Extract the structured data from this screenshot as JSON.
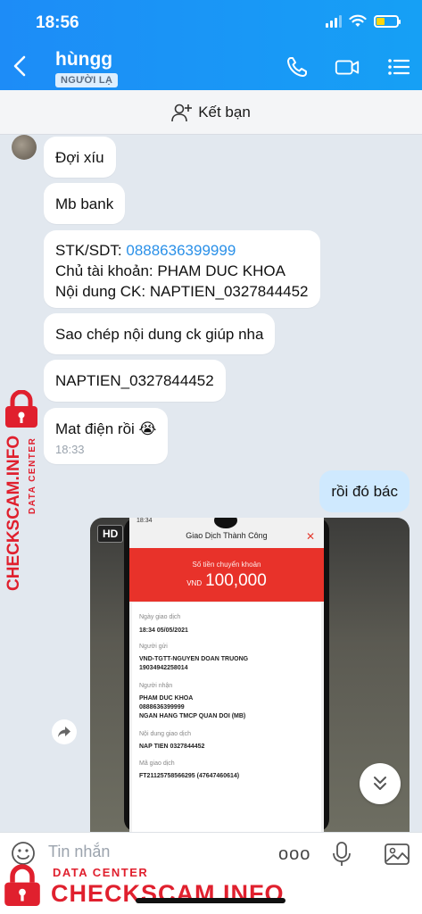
{
  "status_bar": {
    "time": "18:56"
  },
  "header": {
    "contact_name": "hùngg",
    "contact_badge": "NGƯỜI LẠ"
  },
  "add_friend": {
    "label": "Kết bạn"
  },
  "messages": [
    {
      "text": "Đợi xíu"
    },
    {
      "text": "Mb bank"
    },
    {
      "lines": [
        "STK/SDT: ",
        "Chủ tài khoản: PHAM DUC KHOA",
        "Nội dung CK: NAPTIEN_0327844452"
      ],
      "phone": "0888636399999"
    },
    {
      "text": "Sao chép nội dung ck giúp nha"
    },
    {
      "text": "NAPTIEN_0327844452"
    },
    {
      "text": "Mat điện rồi 😭",
      "time": "18:33"
    }
  ],
  "outgoing": {
    "text": "rồi đó bác"
  },
  "photo": {
    "badge": "HD",
    "screen": {
      "status_time": "18:34",
      "title": "Giao Dịch Thành Công",
      "amount_label": "Số tiền chuyển khoản",
      "currency": "VND",
      "amount": "100,000",
      "date_label": "Ngày giao dịch",
      "date": "18:34 05/05/2021",
      "sender_label": "Người gửi",
      "sender": "VND-TGTT-NGUYEN DOAN TRUONG",
      "sender_acct": "19034942258014",
      "receiver_label": "Người nhận",
      "receiver_name": "PHAM DUC KHOA",
      "receiver_acct": "0888636399999",
      "receiver_bank": "NGAN HANG TMCP QUAN DOI (MB)",
      "content_label": "Nội dung giao dịch",
      "content": "NAP TIEN 0327844452",
      "txn_label": "Mã giao dịch",
      "txn": "FT21125758566295 (47647460614)"
    }
  },
  "composer": {
    "placeholder": "Tin nhắn",
    "more": "ooo"
  },
  "watermark": {
    "vertical_text": "CHECKSCAM.INFO",
    "vertical_sub": "DATA CENTER",
    "bottom_sub": "DATA CENTER",
    "bottom_text": "CHECKSCAM.INFO"
  },
  "colors": {
    "header": "#1d8cf7",
    "outgoing_bubble": "#cfe9fe",
    "link": "#2a90e8",
    "watermark": "#e0202e"
  }
}
